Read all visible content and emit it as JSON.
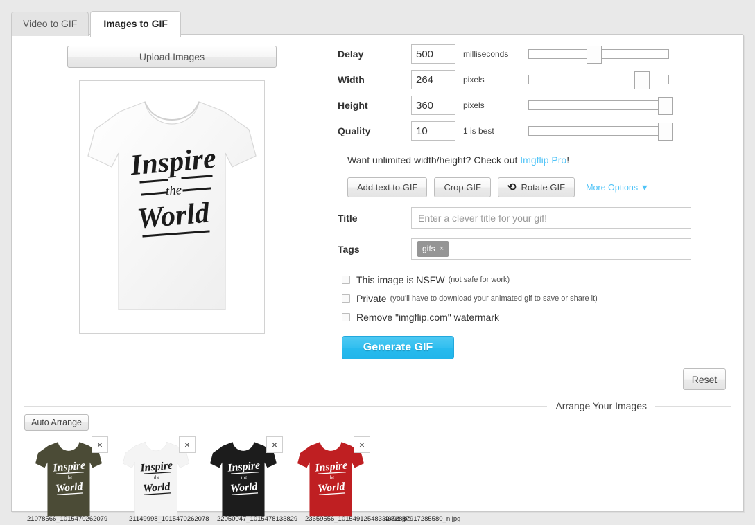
{
  "tabs": [
    {
      "label": "Video to GIF",
      "active": false
    },
    {
      "label": "Images to GIF",
      "active": true
    }
  ],
  "left": {
    "upload_label": "Upload Images",
    "preview_alt": "white t-shirt with Inspire the World script print",
    "preview_text_line1": "Inspire",
    "preview_text_line2": "the",
    "preview_text_line3": "World"
  },
  "settings": [
    {
      "label": "Delay",
      "value": "500",
      "unit": "milliseconds",
      "slider_pct": 47
    },
    {
      "label": "Width",
      "value": "264",
      "unit": "pixels",
      "slider_pct": 81
    },
    {
      "label": "Height",
      "value": "360",
      "unit": "pixels",
      "slider_pct": 98
    },
    {
      "label": "Quality",
      "value": "10",
      "unit": "1 is best",
      "slider_pct": 98
    }
  ],
  "pro": {
    "text_before": "Want unlimited width/height? Check out ",
    "link": "Imgflip Pro",
    "text_after": "!",
    "link_color": "#4fc3f7"
  },
  "actions": {
    "add_text": "Add text to GIF",
    "crop": "Crop GIF",
    "rotate": "Rotate GIF",
    "rotate_icon": "rotate-cw-icon",
    "more_options": "More Options ▼"
  },
  "fields": {
    "title_label": "Title",
    "title_value": "",
    "title_placeholder": "Enter a clever title for your gif!",
    "tags_label": "Tags",
    "tags": [
      {
        "label": "gifs",
        "remove": "×"
      }
    ]
  },
  "checkboxes": [
    {
      "main": "This image is NSFW",
      "sub": "(not safe for work)",
      "checked": false
    },
    {
      "main": "Private",
      "sub": "(you'll have to download your animated gif to save or share it)",
      "checked": false
    },
    {
      "main": "Remove \"imgflip.com\" watermark",
      "sub": "",
      "checked": false
    }
  ],
  "buttons": {
    "generate": "Generate GIF",
    "generate_color": "#2ebdef",
    "reset": "Reset",
    "auto_arrange": "Auto Arrange"
  },
  "arrange": {
    "heading": "Arrange Your Images"
  },
  "thumbnails": [
    {
      "color": "#4b4b36",
      "print_color": "#ffffff",
      "remove": "×",
      "filename": "21078566_1015470262079"
    },
    {
      "color": "#f2f2f2",
      "print_color": "#1a1a1a",
      "remove": "×",
      "filename": "21149998_1015470262078"
    },
    {
      "color": "#1c1c1c",
      "print_color": "#ffffff",
      "remove": "×",
      "filename": "22050047_1015478133829"
    },
    {
      "color": "#bf1f22",
      "print_color": "#ffffff",
      "remove": "×",
      "filename": "23659556_10154912548332491.jpg"
    }
  ],
  "extra_filename": "4652887917285580_n.jpg",
  "shirt_print": {
    "line1": "Inspire",
    "line2": "the",
    "line3": "World"
  }
}
